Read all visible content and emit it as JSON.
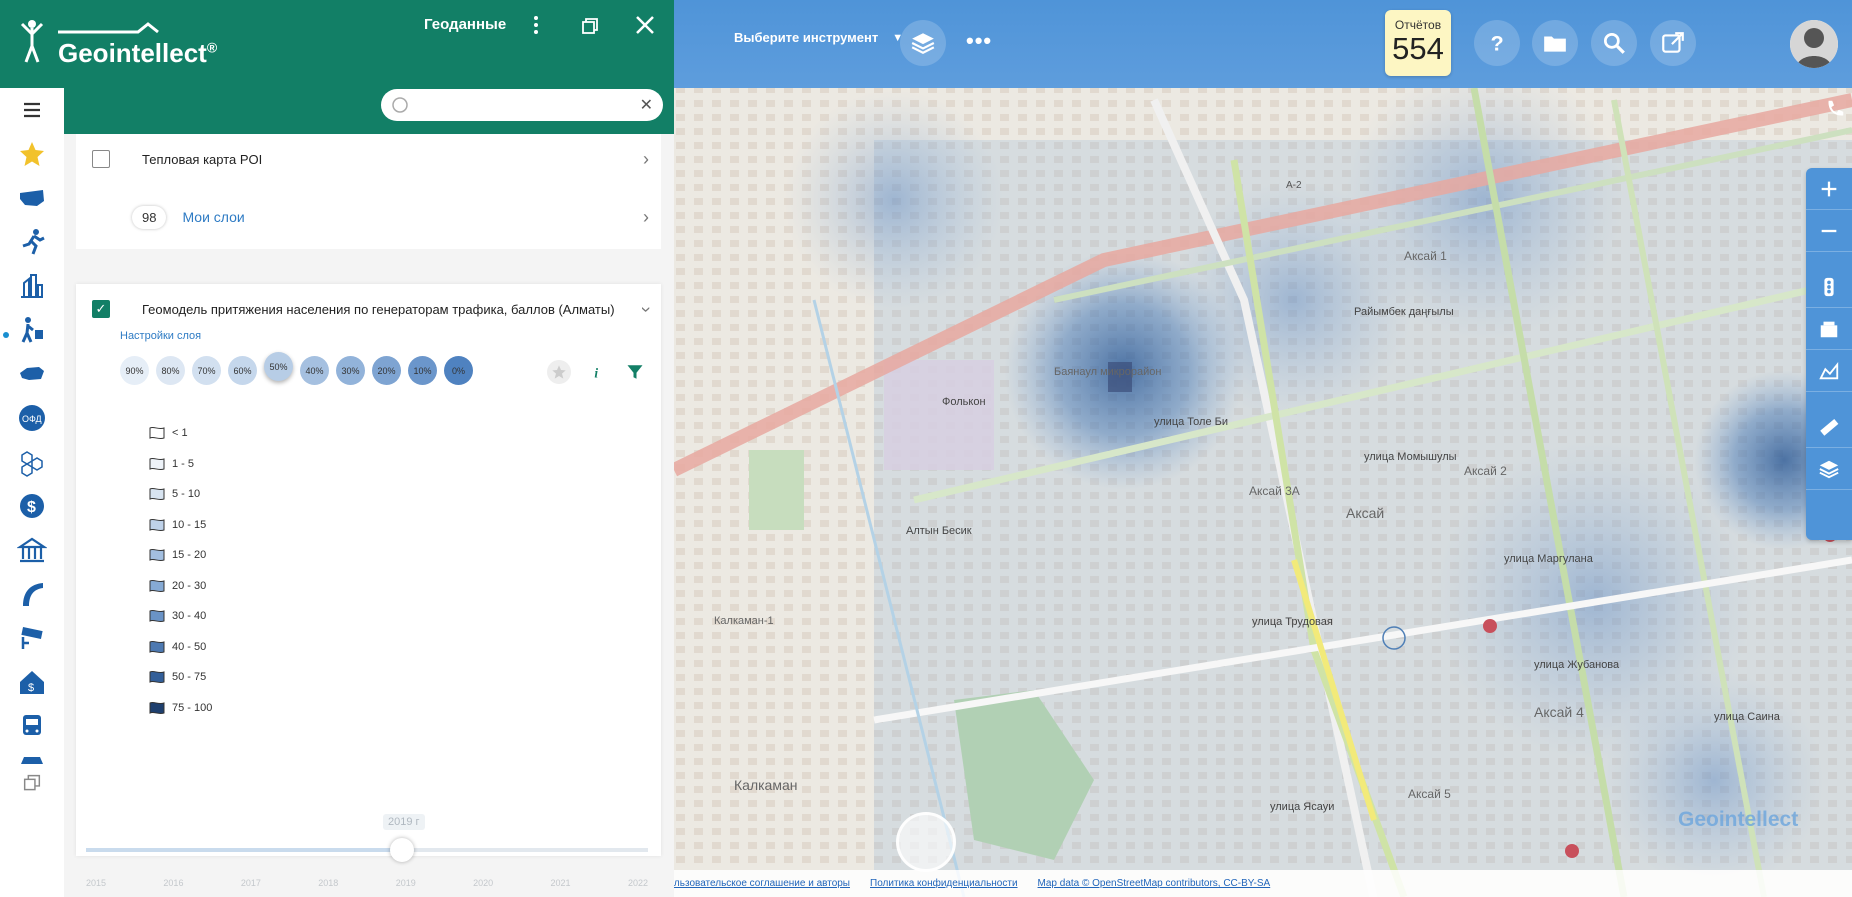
{
  "header": {
    "logo_text": "Geointellect",
    "logo_mark": "®",
    "panel_title": "Геоданные"
  },
  "search": {
    "placeholder": "",
    "value": ""
  },
  "layers": {
    "heatmap_poi": {
      "label": "Тепловая карта POI",
      "checked": false
    },
    "my_layers": {
      "count": "98",
      "label": "Мои слои"
    },
    "geomodel": {
      "label": "Геомодель притяжения населения по генераторам трафика, баллов (Алматы)",
      "checked": true,
      "settings_label": "Настройки слоя",
      "opacity_options": [
        "90%",
        "80%",
        "70%",
        "60%",
        "50%",
        "40%",
        "30%",
        "20%",
        "10%",
        "0%"
      ],
      "opacity_selected": "50%",
      "legend": [
        "< 1",
        "1 - 5",
        "5 - 10",
        "10 - 15",
        "15 - 20",
        "20 - 30",
        "30 - 40",
        "40 - 50",
        "50 - 75",
        "75 - 100"
      ]
    }
  },
  "timeline": {
    "current_label": "2019 г",
    "years": [
      "2015",
      "2016",
      "2017",
      "2018",
      "2019",
      "2020",
      "2021",
      "2022"
    ]
  },
  "toolbar": {
    "tool_select_label": "Выберите инструмент",
    "reports_label": "Отчётов",
    "reports_count": "554"
  },
  "map": {
    "labels": {
      "falcon": "Фолькон",
      "baynaul": "Баянаул микрорайон",
      "altyn": "Алтын Бесик",
      "kalkaman": "Калкаман",
      "kalkaman1": "Калкаман-1",
      "aksai": "Аксай",
      "aksai1": "Аксай 1",
      "aksai2": "Аксай 2",
      "aksai3a": "Аксай 3А",
      "aksai4": "Аксай 4",
      "aksai5": "Аксай 5",
      "toli_bi": "улица Толе Би",
      "raiymbek": "Райымбек даңғылы",
      "momyshuly": "улица Момышулы",
      "yasaui": "улица Ясауи",
      "margulan": "улица Маргулана",
      "trudovaya": "улица Трудовая",
      "zhubanova": "улица Жубанова",
      "sain": "улица Саина",
      "a2": "A-2"
    },
    "footer": {
      "agreement": "Пользовательское соглашение и авторы",
      "privacy": "Политика конфиденциальности",
      "osm": "Map data © OpenStreetMap contributors, CC-BY-SA"
    },
    "watermark": "Geointellect"
  },
  "colors": {
    "brand_green": "#127f66",
    "toolbar_blue": "#4f94d8",
    "link_blue": "#2e7bc4",
    "heat_blue": "#1f4f8f"
  },
  "icons": {
    "rail": [
      "menu-icon",
      "star-icon",
      "usa-map-icon",
      "runner-icon",
      "city-icon",
      "walker-icon",
      "russia-map-icon",
      "ofd-icon",
      "hexagon-icon",
      "dollar-icon",
      "bank-icon",
      "road-icon",
      "camera-icon",
      "house-dollar-icon",
      "bus-icon",
      "car-icon",
      "copy-icon"
    ]
  }
}
